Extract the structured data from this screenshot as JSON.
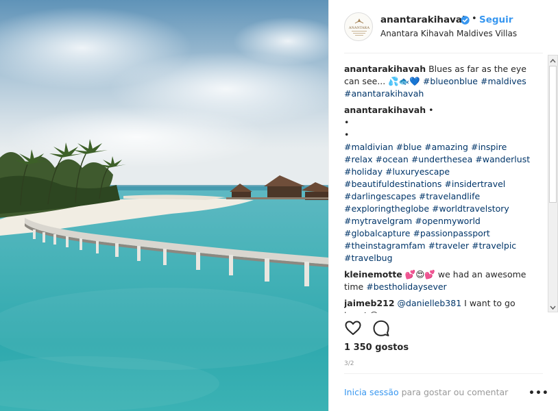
{
  "post": {
    "username": "anantarakihavah",
    "follow_label": "Seguir",
    "separator": "•",
    "location": "Anantara Kihavah Maldives Villas",
    "avatar_text": "ANANTARA"
  },
  "comments": {
    "caption_user": "anantarakihavah",
    "caption_text": "Blues as far as the eye can see... 💦🐟💙",
    "caption_tags": [
      "#blueonblue",
      "#maldives",
      "#anantarakihavah"
    ],
    "second_user": "anantarakihavah",
    "second_dot": "•",
    "bullet1": "•",
    "bullet2": "•",
    "hashtags": [
      "#maldivian",
      "#blue",
      "#amazing",
      "#inspire",
      "#relax",
      "#ocean",
      "#underthesea",
      "#wanderlust",
      "#holiday",
      "#luxuryescape",
      "#beautifuldestinations",
      "#insidertravel",
      "#darlingescapes",
      "#travelandlife",
      "#exploringtheglobe",
      "#worldtravelstory",
      "#mytravelgram",
      "#openmyworld",
      "#globalcapture",
      "#passionpassport",
      "#theinstagramfam",
      "#traveler",
      "#travelpic",
      "#travelbug"
    ],
    "third_user": "kleinemotte",
    "third_emoji": "💕😍💕",
    "third_text": "we had an awesome time",
    "third_tag": "#bestholidaysever",
    "fourth_user": "jaimeb212",
    "fourth_mention": "@danielleb381",
    "fourth_text": "I want to go here! 😍"
  },
  "footer": {
    "likes": "1 350 gostos",
    "pager": "3/2",
    "login_link": "Inicia sessão",
    "login_rest": "para gostar ou comentar",
    "more": "•••"
  },
  "icons": {
    "like": "heart-icon",
    "comment": "comment-bubble-icon",
    "verified": "verified-badge-icon",
    "more": "more-options-icon"
  },
  "colors": {
    "link": "#3897f0",
    "hashtag": "#003569",
    "verified": "#3897f0"
  }
}
